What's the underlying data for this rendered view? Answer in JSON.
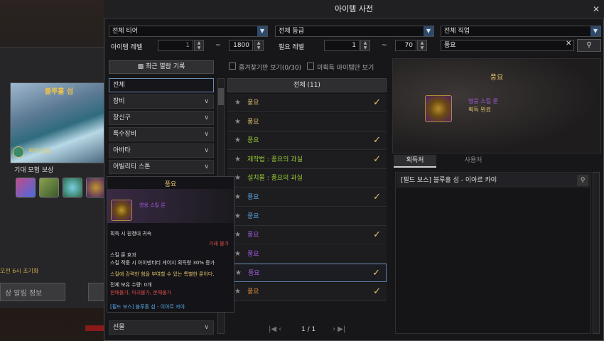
{
  "background": {
    "island_title": "블루홀 섬",
    "island_status": "획득 완료",
    "rewards_label": "기대 모험 보상",
    "reset_notice": "오전 6시 초기화",
    "info_button": "상 알림 정보"
  },
  "window": {
    "title": "아이템 사전",
    "close": "✕"
  },
  "filters": {
    "tier": "전체 티어",
    "grade": "전체 등급",
    "job": "전체 직업",
    "item_level_label": "아이템 레벨",
    "item_level_min": "1",
    "item_level_max": "1800",
    "required_level_label": "필요 레벨",
    "required_level_min": "1",
    "required_level_max": "70",
    "range_sep": "~",
    "search_value": "풍요",
    "search_clear": "✕",
    "search_icon": "search-icon"
  },
  "left": {
    "recent_button": "최근 열람 기록",
    "categories": [
      {
        "label": "전체",
        "active": true
      },
      {
        "label": "장비"
      },
      {
        "label": "장신구"
      },
      {
        "label": "특수장비"
      },
      {
        "label": "아바타"
      },
      {
        "label": "어빌리티 스톤"
      },
      {
        "label": "선물"
      }
    ]
  },
  "middle": {
    "favorites_only": "즐겨찾기만 보기(0/30)",
    "unobtained_only": "미획득 아이템만 보기",
    "list_header": "전체 (11)",
    "rows": [
      {
        "name": "풍요",
        "color": "#e3c36a",
        "checked": true
      },
      {
        "name": "풍요",
        "color": "#e3c36a",
        "checked": false
      },
      {
        "name": "풍요",
        "color": "#9acd32",
        "checked": true
      },
      {
        "name": "제작법 : 풍요의 과실",
        "color": "#9acd32",
        "checked": true
      },
      {
        "name": "설치물 : 풍요의 과실",
        "color": "#9acd32",
        "checked": false
      },
      {
        "name": "풍요",
        "color": "#5aa9e6",
        "checked": true
      },
      {
        "name": "풍요",
        "color": "#5aa9e6",
        "checked": false
      },
      {
        "name": "풍요",
        "color": "#a45be0",
        "checked": true
      },
      {
        "name": "풍요",
        "color": "#a45be0",
        "checked": false
      },
      {
        "name": "풍요",
        "color": "#a45be0",
        "checked": true
      },
      {
        "name": "풍요",
        "color": "#e8923a",
        "checked": true
      }
    ],
    "pager": "1 / 1"
  },
  "right": {
    "title": "풍요",
    "grade": "영웅 스킬 룬",
    "status": "획득 완료",
    "tab_obtain": "획득처",
    "tab_use": "사용처",
    "source": "[필드 보스] 블루홀 섬 - 이아르 카야"
  },
  "tooltip": {
    "title": "풍요",
    "grade": "영웅 스킬 룬",
    "bind": "획득 시 원정대 귀속",
    "trade": "거래 불가",
    "effect_label": "스킬 룬 효과",
    "effect": "스킬 적중 시 아이덴티티 게이지 획득량 30% 증가",
    "desc": "스킬에 강력한 힘을 부여할 수 있는 특별한 룬이다.",
    "owned": "전체 보유 수량: 0개",
    "restrict": "판매불가, 파괴불가, 분해불가",
    "source": "[필드 보스] 블루홀 섬 - 이아르 카야"
  }
}
